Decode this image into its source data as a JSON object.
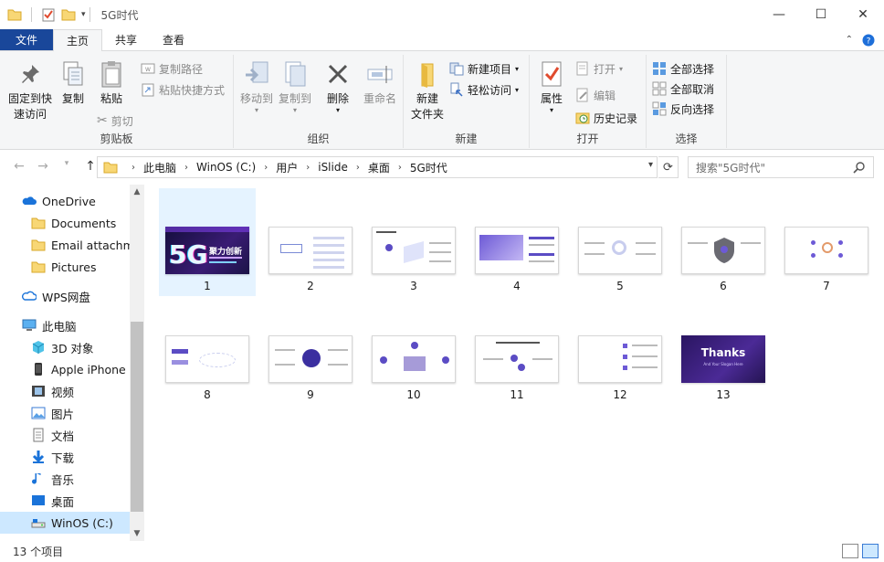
{
  "titlebar": {
    "title": "5G时代",
    "minimize": "—",
    "maximize": "☐",
    "close": "✕"
  },
  "tabs": {
    "file": "文件",
    "home": "主页",
    "share": "共享",
    "view": "查看"
  },
  "ribbon": {
    "clipboard": {
      "label": "剪贴板",
      "pin": "固定到快\n速访问",
      "pin_line1": "固定到快",
      "pin_line2": "速访问",
      "copy": "复制",
      "paste": "粘贴",
      "copy_path": "复制路径",
      "paste_shortcut": "粘贴快捷方式",
      "cut": "剪切"
    },
    "organize": {
      "label": "组织",
      "move_to": "移动到",
      "copy_to": "复制到",
      "delete": "删除",
      "rename": "重命名"
    },
    "new": {
      "label": "新建",
      "new_folder_line1": "新建",
      "new_folder_line2": "文件夹",
      "new_item": "新建项目",
      "easy_access": "轻松访问"
    },
    "open": {
      "label": "打开",
      "properties": "属性",
      "open": "打开",
      "edit": "编辑",
      "history": "历史记录"
    },
    "select": {
      "label": "选择",
      "select_all": "全部选择",
      "select_none": "全部取消",
      "invert": "反向选择"
    }
  },
  "address": {
    "crumbs": [
      "此电脑",
      "WinOS (C:)",
      "用户",
      "iSlide",
      "桌面",
      "5G时代"
    ],
    "search_placeholder": "搜索\"5G时代\""
  },
  "nav": {
    "items": [
      {
        "label": "OneDrive",
        "icon": "cloud-icon"
      },
      {
        "label": "Documents",
        "icon": "folder-icon"
      },
      {
        "label": "Email attachme",
        "icon": "folder-icon"
      },
      {
        "label": "Pictures",
        "icon": "folder-icon"
      },
      {
        "label": "WPS网盘",
        "icon": "cloud-icon"
      },
      {
        "label": "此电脑",
        "icon": "computer-icon"
      },
      {
        "label": "3D 对象",
        "icon": "cube-icon"
      },
      {
        "label": "Apple iPhone",
        "icon": "phone-icon"
      },
      {
        "label": "视频",
        "icon": "video-icon"
      },
      {
        "label": "图片",
        "icon": "picture-icon"
      },
      {
        "label": "文档",
        "icon": "document-icon"
      },
      {
        "label": "下载",
        "icon": "download-icon"
      },
      {
        "label": "音乐",
        "icon": "music-icon"
      },
      {
        "label": "桌面",
        "icon": "desktop-icon"
      },
      {
        "label": "WinOS (C:)",
        "icon": "drive-icon"
      }
    ]
  },
  "files": [
    "1",
    "2",
    "3",
    "4",
    "5",
    "6",
    "7",
    "8",
    "9",
    "10",
    "11",
    "12",
    "13"
  ],
  "slide1": {
    "big": "5G",
    "sub": "聚力创新"
  },
  "slide13": {
    "big": "Thanks",
    "sub": "And Your Slogan Here"
  },
  "status": {
    "count": "13 个项目"
  },
  "colors": {
    "accent": "#19479a",
    "selection": "#cce8ff",
    "slide_purple": "#3d1f7a"
  }
}
